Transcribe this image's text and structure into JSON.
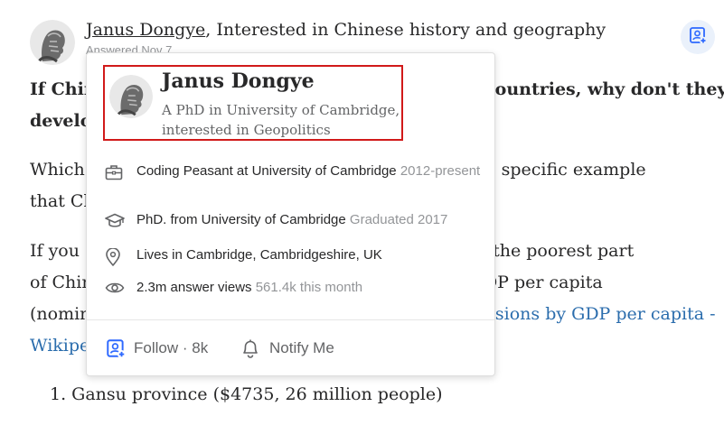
{
  "header": {
    "author_name": "Janus Dongye",
    "author_credential": ", Interested in Chinese history and geography",
    "meta": "Answered Nov 7"
  },
  "answer": {
    "p1_line1": "If China has poorer regions than many African countries, why don't they",
    "p1_line2": "develop those regions first?",
    "p2_line1": "Which region? I guess it's better if I give you just one specific example",
    "p2_line2": "that China is developing in poor regions.",
    "p3_line1": "If you are looking at the wiki, the top 5 regions from the poorest part",
    "p3_line2": "of China, measured by GDP per capita, are below. GDP per capita",
    "p3_line3_prefix": "(nominal) in 2017 (",
    "p3_line3_link": "List of Chinese administrative divisions by GDP per capita -",
    "p3_line4_link": "Wikipedia",
    "p3_line4_suffix": "):",
    "list_item_1": "1. Gansu province ($4735, 26 million people)"
  },
  "popup": {
    "name": "Janus Dongye",
    "bio_line1": "A PhD in University of Cambridge,",
    "bio_line2": "interested in Geopolitics",
    "credentials": [
      {
        "icon": "briefcase-icon",
        "text": "Coding Peasant at University of Cambridge",
        "muted": "2012-present"
      },
      {
        "icon": "graduation-cap-icon",
        "text": "PhD. from University of Cambridge",
        "muted": "Graduated 2017"
      },
      {
        "icon": "location-pin-icon",
        "text": "Lives in Cambridge, Cambridgeshire, UK",
        "muted": ""
      },
      {
        "icon": "eye-icon",
        "text": "2.3m answer views",
        "muted": "561.4k this month"
      }
    ],
    "follow_label": "Follow",
    "follow_sep": " · ",
    "follow_count": "8k",
    "notify_label": "Notify Me"
  },
  "colors": {
    "highlight_border": "#d11a1a",
    "link": "#2b6dad",
    "icon_blue": "#2e69ff"
  }
}
